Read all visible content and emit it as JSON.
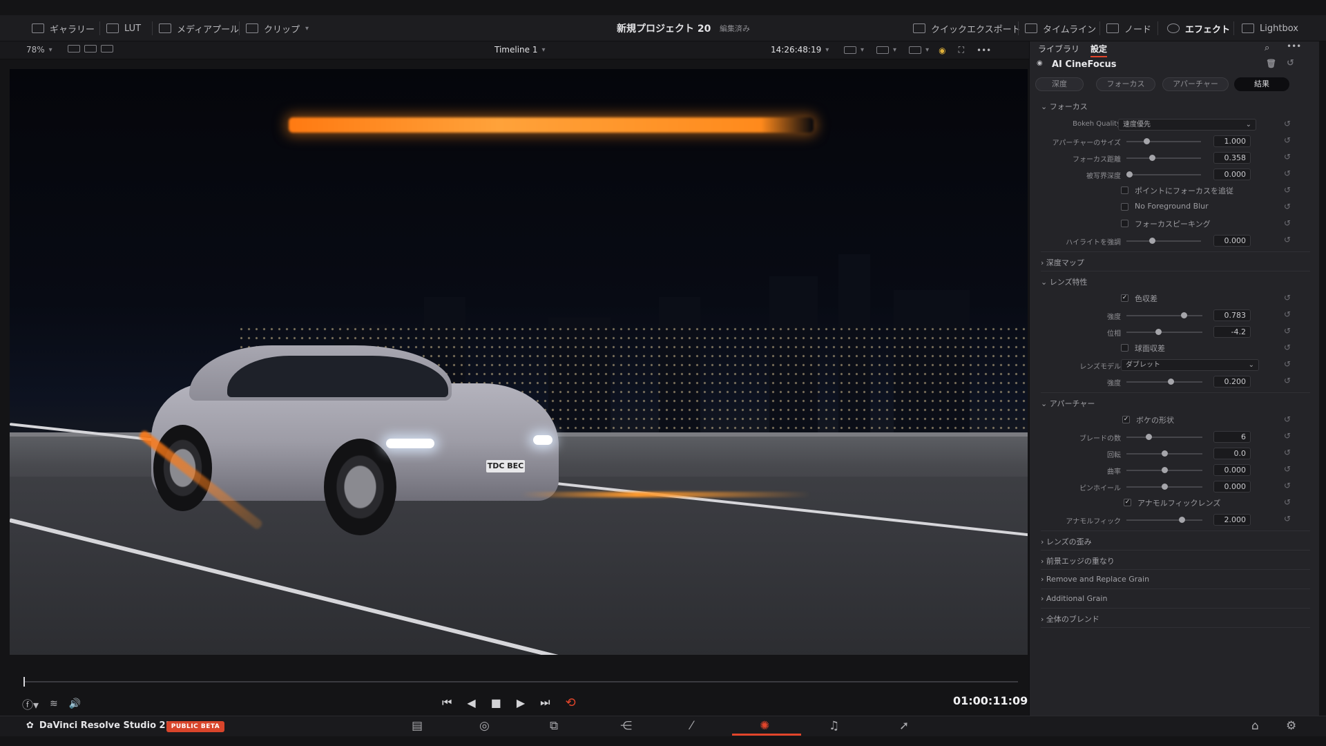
{
  "toolbar": {
    "gallery": "ギャラリー",
    "lut": "LUT",
    "media_pool": "メディアプール",
    "clip": "クリップ",
    "project_title": "新規プロジェクト 20",
    "project_status": "編集済み",
    "quick_export": "クイックエクスポート",
    "timeline": "タイムライン",
    "nodes": "ノード",
    "effects": "エフェクト",
    "lightbox": "Lightbox"
  },
  "viewerbar": {
    "zoom": "78%",
    "timeline_name": "Timeline 1",
    "source_timecode": "14:26:48:19"
  },
  "viewer": {
    "plate_text": "TDC BEC"
  },
  "transport": {
    "timecode": "01:00:11:09"
  },
  "pagebar": {
    "app_name": "DaVinci Resolve Studio 21",
    "beta_badge": "PUBLIC BETA"
  },
  "inspector": {
    "tabs": [
      "ライブラリ",
      "設定"
    ],
    "effect_name": "AI CineFocus",
    "segments": [
      "深度",
      "フォーカス",
      "アパーチャー",
      "結果"
    ],
    "focus_section": "フォーカス",
    "bokeh_quality_label": "Bokeh Quality",
    "bokeh_quality_value": "速度優先",
    "aperture_size_label": "アパーチャーのサイズ",
    "aperture_size_value": "1.000",
    "focus_distance_label": "フォーカス距離",
    "focus_distance_value": "0.358",
    "dof_label": "被写界深度",
    "dof_value": "0.000",
    "track_focus_label": "ポイントにフォーカスを追従",
    "no_fg_blur_label": "No Foreground Blur",
    "focus_peaking_label": "フォーカスピーキング",
    "highlight_label": "ハイライトを強調",
    "highlight_value": "0.000",
    "depth_map_section": "深度マップ",
    "lens_section": "レンズ特性",
    "chromatic_label": "色収差",
    "strength_label": "強度",
    "strength_value": "0.783",
    "phase_label": "位相",
    "phase_value": "-4.2",
    "spherical_label": "球面収差",
    "lens_model_label": "レンズモデル",
    "lens_model_value": "ダブレット",
    "strength2_label": "強度",
    "strength2_value": "0.200",
    "aperture_section": "アパーチャー",
    "bokeh_shape_label": "ボケの形状",
    "blades_label": "ブレードの数",
    "blades_value": "6",
    "rotation_label": "回転",
    "rotation_value": "0.0",
    "curvature_label": "曲率",
    "curvature_value": "0.000",
    "pinwheel_label": "ピンホイール",
    "pinwheel_value": "0.000",
    "anamorphic_lens_label": "アナモルフィックレンズ",
    "anamorphic_label": "アナモルフィック",
    "anamorphic_value": "2.000",
    "lens_distortion": "レンズの歪み",
    "edge_overlap": "前景エッジの重なり",
    "remove_grain": "Remove and Replace Grain",
    "additional_grain": "Additional Grain",
    "global_blend": "全体のブレンド"
  },
  "slider_levels": {
    "aperture_size": 0.25,
    "focus_distance": 0.33,
    "dof": 0.0,
    "highlight": 0.33,
    "strength": 0.78,
    "phase": 0.42,
    "strength2": 0.59,
    "blades": 0.28,
    "rotation": 0.5,
    "curvature": 0.5,
    "pinwheel": 0.5,
    "anamorphic": 0.75
  },
  "colors": {
    "accent": "#e2452b",
    "panel": "#242428"
  }
}
